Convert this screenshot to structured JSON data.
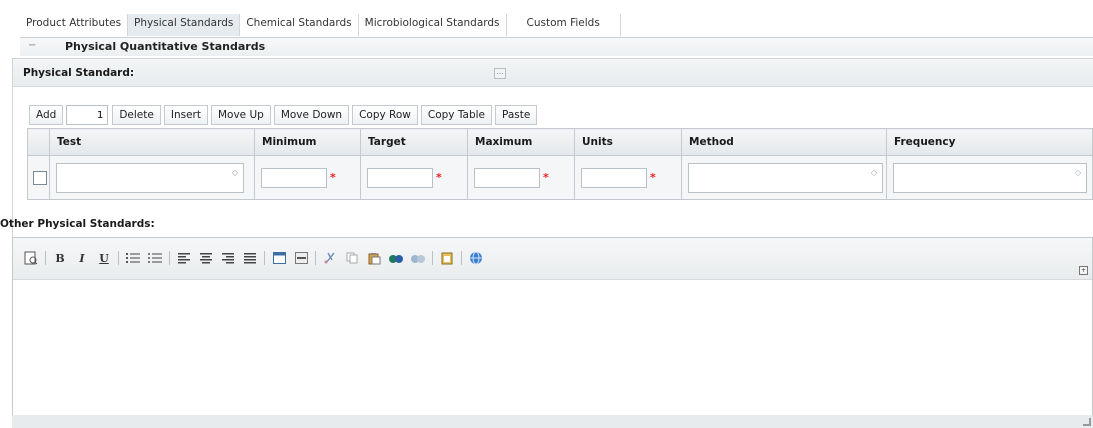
{
  "tabs": [
    {
      "label": "Product Attributes",
      "active": false
    },
    {
      "label": "Physical Standards",
      "active": true
    },
    {
      "label": "Chemical Standards",
      "active": false
    },
    {
      "label": "Microbiological Standards",
      "active": false
    },
    {
      "label": "Custom Fields",
      "active": false
    }
  ],
  "section": {
    "toggle_glyph": "−",
    "title": "Physical Quantitative Standards"
  },
  "physical_standard": {
    "label": "Physical Standard:",
    "ellipsis": "..."
  },
  "toolbar": {
    "add": "Add",
    "row_count": "1",
    "delete": "Delete",
    "insert": "Insert",
    "move_up": "Move Up",
    "move_down": "Move Down",
    "copy_row": "Copy Row",
    "copy_table": "Copy Table",
    "paste": "Paste"
  },
  "grid": {
    "columns": [
      "Test",
      "Minimum",
      "Target",
      "Maximum",
      "Units",
      "Method",
      "Frequency"
    ],
    "required_marker": "*",
    "spin_glyph": "◇"
  },
  "other_standards": {
    "label": "Other Physical Standards:"
  },
  "editor": {
    "tools": [
      "source-icon",
      "bold-icon",
      "italic-icon",
      "underline-icon",
      "numbered-list-icon",
      "bulleted-list-icon",
      "align-left-icon",
      "align-center-icon",
      "align-right-icon",
      "justify-icon",
      "table-icon",
      "horizontal-rule-icon",
      "cut-icon",
      "copy-icon",
      "paste-icon",
      "spellcheck-icon",
      "find-icon",
      "paste-word-icon",
      "link-icon"
    ],
    "bold": "B",
    "italic": "I",
    "underline": "U",
    "expand": "+"
  },
  "colors": {
    "required": "#ee2222",
    "active_tab": "#e6ebef"
  }
}
